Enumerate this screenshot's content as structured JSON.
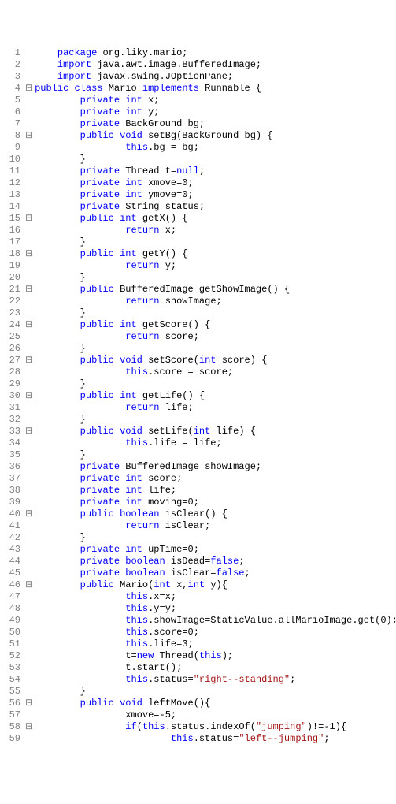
{
  "lines": [
    {
      "n": 1,
      "fold": "",
      "indent": 1,
      "tokens": [
        {
          "t": "package ",
          "c": "kw"
        },
        {
          "t": "org.liky.mario;",
          "c": ""
        }
      ]
    },
    {
      "n": 2,
      "fold": "",
      "indent": 1,
      "tokens": [
        {
          "t": "import ",
          "c": "kw"
        },
        {
          "t": "java.awt.image.BufferedImage;",
          "c": ""
        }
      ]
    },
    {
      "n": 3,
      "fold": "",
      "indent": 1,
      "tokens": [
        {
          "t": "import ",
          "c": "kw"
        },
        {
          "t": "javax.swing.JOptionPane;",
          "c": ""
        }
      ]
    },
    {
      "n": 4,
      "fold": "⊟",
      "indent": 0,
      "tokens": [
        {
          "t": "public class ",
          "c": "kw"
        },
        {
          "t": "Mario ",
          "c": ""
        },
        {
          "t": "implements ",
          "c": "kw"
        },
        {
          "t": "Runnable {",
          "c": ""
        }
      ]
    },
    {
      "n": 5,
      "fold": "",
      "indent": 2,
      "tokens": [
        {
          "t": "private int ",
          "c": "kw"
        },
        {
          "t": "x;",
          "c": ""
        }
      ]
    },
    {
      "n": 6,
      "fold": "",
      "indent": 2,
      "tokens": [
        {
          "t": "private int ",
          "c": "kw"
        },
        {
          "t": "y;",
          "c": ""
        }
      ]
    },
    {
      "n": 7,
      "fold": "",
      "indent": 2,
      "tokens": [
        {
          "t": "private ",
          "c": "kw"
        },
        {
          "t": "BackGround bg;",
          "c": ""
        }
      ]
    },
    {
      "n": 8,
      "fold": "⊟",
      "indent": 2,
      "tokens": [
        {
          "t": "public void ",
          "c": "kw"
        },
        {
          "t": "setBg(BackGround bg) {",
          "c": ""
        }
      ]
    },
    {
      "n": 9,
      "fold": "",
      "indent": 4,
      "tokens": [
        {
          "t": "this",
          "c": "kw"
        },
        {
          "t": ".bg = bg;",
          "c": ""
        }
      ]
    },
    {
      "n": 10,
      "fold": "",
      "indent": 2,
      "tokens": [
        {
          "t": "}",
          "c": ""
        }
      ]
    },
    {
      "n": 11,
      "fold": "",
      "indent": 2,
      "tokens": [
        {
          "t": "private ",
          "c": "kw"
        },
        {
          "t": "Thread t=",
          "c": ""
        },
        {
          "t": "null",
          "c": "kw"
        },
        {
          "t": ";",
          "c": ""
        }
      ]
    },
    {
      "n": 12,
      "fold": "",
      "indent": 2,
      "tokens": [
        {
          "t": "private int ",
          "c": "kw"
        },
        {
          "t": "xmove=0;",
          "c": ""
        }
      ]
    },
    {
      "n": 13,
      "fold": "",
      "indent": 2,
      "tokens": [
        {
          "t": "private int ",
          "c": "kw"
        },
        {
          "t": "ymove=0;",
          "c": ""
        }
      ]
    },
    {
      "n": 14,
      "fold": "",
      "indent": 2,
      "tokens": [
        {
          "t": "private ",
          "c": "kw"
        },
        {
          "t": "String status;",
          "c": ""
        }
      ]
    },
    {
      "n": 15,
      "fold": "⊟",
      "indent": 2,
      "tokens": [
        {
          "t": "public int ",
          "c": "kw"
        },
        {
          "t": "getX() {",
          "c": ""
        }
      ]
    },
    {
      "n": 16,
      "fold": "",
      "indent": 4,
      "tokens": [
        {
          "t": "return ",
          "c": "kw"
        },
        {
          "t": "x;",
          "c": ""
        }
      ]
    },
    {
      "n": 17,
      "fold": "",
      "indent": 2,
      "tokens": [
        {
          "t": "}",
          "c": ""
        }
      ]
    },
    {
      "n": 18,
      "fold": "⊟",
      "indent": 2,
      "tokens": [
        {
          "t": "public int ",
          "c": "kw"
        },
        {
          "t": "getY() {",
          "c": ""
        }
      ]
    },
    {
      "n": 19,
      "fold": "",
      "indent": 4,
      "tokens": [
        {
          "t": "return ",
          "c": "kw"
        },
        {
          "t": "y;",
          "c": ""
        }
      ]
    },
    {
      "n": 20,
      "fold": "",
      "indent": 2,
      "tokens": [
        {
          "t": "}",
          "c": ""
        }
      ]
    },
    {
      "n": 21,
      "fold": "⊟",
      "indent": 2,
      "tokens": [
        {
          "t": "public ",
          "c": "kw"
        },
        {
          "t": "BufferedImage getShowImage() {",
          "c": ""
        }
      ]
    },
    {
      "n": 22,
      "fold": "",
      "indent": 4,
      "tokens": [
        {
          "t": "return ",
          "c": "kw"
        },
        {
          "t": "showImage;",
          "c": ""
        }
      ]
    },
    {
      "n": 23,
      "fold": "",
      "indent": 2,
      "tokens": [
        {
          "t": "}",
          "c": ""
        }
      ]
    },
    {
      "n": 24,
      "fold": "⊟",
      "indent": 2,
      "tokens": [
        {
          "t": "public int ",
          "c": "kw"
        },
        {
          "t": "getScore() {",
          "c": ""
        }
      ]
    },
    {
      "n": 25,
      "fold": "",
      "indent": 4,
      "tokens": [
        {
          "t": "return ",
          "c": "kw"
        },
        {
          "t": "score;",
          "c": ""
        }
      ]
    },
    {
      "n": 26,
      "fold": "",
      "indent": 2,
      "tokens": [
        {
          "t": "}",
          "c": ""
        }
      ]
    },
    {
      "n": 27,
      "fold": "⊟",
      "indent": 2,
      "tokens": [
        {
          "t": "public void ",
          "c": "kw"
        },
        {
          "t": "setScore(",
          "c": ""
        },
        {
          "t": "int ",
          "c": "kw"
        },
        {
          "t": "score) {",
          "c": ""
        }
      ]
    },
    {
      "n": 28,
      "fold": "",
      "indent": 4,
      "tokens": [
        {
          "t": "this",
          "c": "kw"
        },
        {
          "t": ".score = score;",
          "c": ""
        }
      ]
    },
    {
      "n": 29,
      "fold": "",
      "indent": 2,
      "tokens": [
        {
          "t": "}",
          "c": ""
        }
      ]
    },
    {
      "n": 30,
      "fold": "⊟",
      "indent": 2,
      "tokens": [
        {
          "t": "public int ",
          "c": "kw"
        },
        {
          "t": "getLife() {",
          "c": ""
        }
      ]
    },
    {
      "n": 31,
      "fold": "",
      "indent": 4,
      "tokens": [
        {
          "t": "return ",
          "c": "kw"
        },
        {
          "t": "life;",
          "c": ""
        }
      ]
    },
    {
      "n": 32,
      "fold": "",
      "indent": 2,
      "tokens": [
        {
          "t": "}",
          "c": ""
        }
      ]
    },
    {
      "n": 33,
      "fold": "⊟",
      "indent": 2,
      "tokens": [
        {
          "t": "public void ",
          "c": "kw"
        },
        {
          "t": "setLife(",
          "c": ""
        },
        {
          "t": "int ",
          "c": "kw"
        },
        {
          "t": "life) {",
          "c": ""
        }
      ]
    },
    {
      "n": 34,
      "fold": "",
      "indent": 4,
      "tokens": [
        {
          "t": "this",
          "c": "kw"
        },
        {
          "t": ".life = life;",
          "c": ""
        }
      ]
    },
    {
      "n": 35,
      "fold": "",
      "indent": 2,
      "tokens": [
        {
          "t": "}",
          "c": ""
        }
      ]
    },
    {
      "n": 36,
      "fold": "",
      "indent": 2,
      "tokens": [
        {
          "t": "private ",
          "c": "kw"
        },
        {
          "t": "BufferedImage showImage;",
          "c": ""
        }
      ]
    },
    {
      "n": 37,
      "fold": "",
      "indent": 2,
      "tokens": [
        {
          "t": "private int ",
          "c": "kw"
        },
        {
          "t": "score;",
          "c": ""
        }
      ]
    },
    {
      "n": 38,
      "fold": "",
      "indent": 2,
      "tokens": [
        {
          "t": "private int ",
          "c": "kw"
        },
        {
          "t": "life;",
          "c": ""
        }
      ]
    },
    {
      "n": 39,
      "fold": "",
      "indent": 2,
      "tokens": [
        {
          "t": "private int ",
          "c": "kw"
        },
        {
          "t": "moving=0;",
          "c": ""
        }
      ]
    },
    {
      "n": 40,
      "fold": "⊟",
      "indent": 2,
      "tokens": [
        {
          "t": "public boolean ",
          "c": "kw"
        },
        {
          "t": "isClear() {",
          "c": ""
        }
      ]
    },
    {
      "n": 41,
      "fold": "",
      "indent": 4,
      "tokens": [
        {
          "t": "return ",
          "c": "kw"
        },
        {
          "t": "isClear;",
          "c": ""
        }
      ]
    },
    {
      "n": 42,
      "fold": "",
      "indent": 2,
      "tokens": [
        {
          "t": "}",
          "c": ""
        }
      ]
    },
    {
      "n": 43,
      "fold": "",
      "indent": 2,
      "tokens": [
        {
          "t": "private int ",
          "c": "kw"
        },
        {
          "t": "upTime=0;",
          "c": ""
        }
      ]
    },
    {
      "n": 44,
      "fold": "",
      "indent": 2,
      "tokens": [
        {
          "t": "private boolean ",
          "c": "kw"
        },
        {
          "t": "isDead=",
          "c": ""
        },
        {
          "t": "false",
          "c": "kw"
        },
        {
          "t": ";",
          "c": ""
        }
      ]
    },
    {
      "n": 45,
      "fold": "",
      "indent": 2,
      "tokens": [
        {
          "t": "private boolean ",
          "c": "kw"
        },
        {
          "t": "isClear=",
          "c": ""
        },
        {
          "t": "false",
          "c": "kw"
        },
        {
          "t": ";",
          "c": ""
        }
      ]
    },
    {
      "n": 46,
      "fold": "⊟",
      "indent": 2,
      "tokens": [
        {
          "t": "public ",
          "c": "kw"
        },
        {
          "t": "Mario(",
          "c": ""
        },
        {
          "t": "int ",
          "c": "kw"
        },
        {
          "t": "x,",
          "c": ""
        },
        {
          "t": "int ",
          "c": "kw"
        },
        {
          "t": "y){",
          "c": ""
        }
      ]
    },
    {
      "n": 47,
      "fold": "",
      "indent": 4,
      "tokens": [
        {
          "t": "this",
          "c": "kw"
        },
        {
          "t": ".x=x;",
          "c": ""
        }
      ]
    },
    {
      "n": 48,
      "fold": "",
      "indent": 4,
      "tokens": [
        {
          "t": "this",
          "c": "kw"
        },
        {
          "t": ".y=y;",
          "c": ""
        }
      ]
    },
    {
      "n": 49,
      "fold": "",
      "indent": 4,
      "tokens": [
        {
          "t": "this",
          "c": "kw"
        },
        {
          "t": ".showImage=StaticValue.allMarioImage.get(0);",
          "c": ""
        }
      ]
    },
    {
      "n": 50,
      "fold": "",
      "indent": 4,
      "tokens": [
        {
          "t": "this",
          "c": "kw"
        },
        {
          "t": ".score=0;",
          "c": ""
        }
      ]
    },
    {
      "n": 51,
      "fold": "",
      "indent": 4,
      "tokens": [
        {
          "t": "this",
          "c": "kw"
        },
        {
          "t": ".life=3;",
          "c": ""
        }
      ]
    },
    {
      "n": 52,
      "fold": "",
      "indent": 4,
      "tokens": [
        {
          "t": "t=",
          "c": ""
        },
        {
          "t": "new ",
          "c": "kw"
        },
        {
          "t": "Thread(",
          "c": ""
        },
        {
          "t": "this",
          "c": "kw"
        },
        {
          "t": ");",
          "c": ""
        }
      ]
    },
    {
      "n": 53,
      "fold": "",
      "indent": 4,
      "tokens": [
        {
          "t": "t.start();",
          "c": ""
        }
      ]
    },
    {
      "n": 54,
      "fold": "",
      "indent": 4,
      "tokens": [
        {
          "t": "this",
          "c": "kw"
        },
        {
          "t": ".status=",
          "c": ""
        },
        {
          "t": "\"right--standing\"",
          "c": "str"
        },
        {
          "t": ";",
          "c": ""
        }
      ]
    },
    {
      "n": 55,
      "fold": "",
      "indent": 2,
      "tokens": [
        {
          "t": "}",
          "c": ""
        }
      ]
    },
    {
      "n": 56,
      "fold": "⊟",
      "indent": 2,
      "tokens": [
        {
          "t": "public void ",
          "c": "kw"
        },
        {
          "t": "leftMove(){",
          "c": ""
        }
      ]
    },
    {
      "n": 57,
      "fold": "",
      "indent": 4,
      "tokens": [
        {
          "t": "xmove=-5;",
          "c": ""
        }
      ]
    },
    {
      "n": 58,
      "fold": "⊟",
      "indent": 4,
      "tokens": [
        {
          "t": "if",
          "c": "kw"
        },
        {
          "t": "(",
          "c": ""
        },
        {
          "t": "this",
          "c": "kw"
        },
        {
          "t": ".status.indexOf(",
          "c": ""
        },
        {
          "t": "\"jumping\"",
          "c": "str"
        },
        {
          "t": ")!=-1){",
          "c": ""
        }
      ]
    },
    {
      "n": 59,
      "fold": "",
      "indent": 6,
      "tokens": [
        {
          "t": "this",
          "c": "kw"
        },
        {
          "t": ".status=",
          "c": ""
        },
        {
          "t": "\"left--jumping\"",
          "c": "str"
        },
        {
          "t": ";",
          "c": ""
        }
      ]
    }
  ]
}
